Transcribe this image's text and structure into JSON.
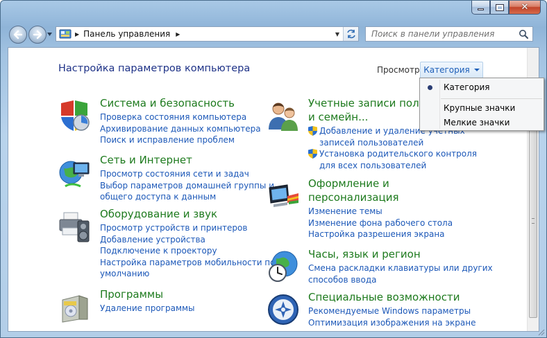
{
  "window": {
    "close_glyph": "✕"
  },
  "address": {
    "path": "Панель управления"
  },
  "search": {
    "placeholder": "Поиск в панели управления"
  },
  "main": {
    "title": "Настройка параметров компьютера",
    "view_label": "Просмотр:",
    "view_value": "Категория"
  },
  "view_menu": {
    "items": [
      "Категория",
      "Крупные значки",
      "Мелкие значки"
    ],
    "selected": "Категория"
  },
  "categories": [
    {
      "title": "Система и безопасность",
      "icon": "security-shield-icon",
      "links": [
        "Проверка состояния компьютера",
        "Архивирование данных компьютера",
        "Поиск и исправление проблем"
      ]
    },
    {
      "title": "Сеть и Интернет",
      "icon": "network-globe-icon",
      "links": [
        "Просмотр состояния сети и задач",
        "Выбор параметров домашней группы и",
        "общего доступа к данным"
      ]
    },
    {
      "title": "Оборудование и звук",
      "icon": "printer-speaker-icon",
      "links": [
        "Просмотр устройств и принтеров",
        "Добавление устройства",
        "Подключение к проектору",
        "Настройка параметров мобильности по",
        "умолчанию"
      ]
    },
    {
      "title": "Программы",
      "icon": "programs-box-icon",
      "links": [
        "Удаление программы"
      ]
    },
    {
      "title_line1": "Учетные записи пользо",
      "title_line2": "и семейн...",
      "icon": "users-icon",
      "links": [
        "Добавление и удаление учетных",
        "записей пользователей",
        "Установка родительского контроля",
        "для всех пользователей"
      ]
    },
    {
      "title_line1": "Оформление и",
      "title_line2": "персонализация",
      "icon": "monitor-palette-icon",
      "links": [
        "Изменение темы",
        "Изменение фона рабочего стола",
        "Настройка разрешения экрана"
      ]
    },
    {
      "title": "Часы, язык и регион",
      "icon": "clock-globe-icon",
      "links": [
        "Смена раскладки клавиатуры или других",
        "способов ввода"
      ]
    },
    {
      "title": "Специальные возможности",
      "icon": "accessibility-icon",
      "links": [
        "Рекомендуемые Windows параметры",
        "Оптимизация изображения на экране"
      ]
    }
  ]
}
